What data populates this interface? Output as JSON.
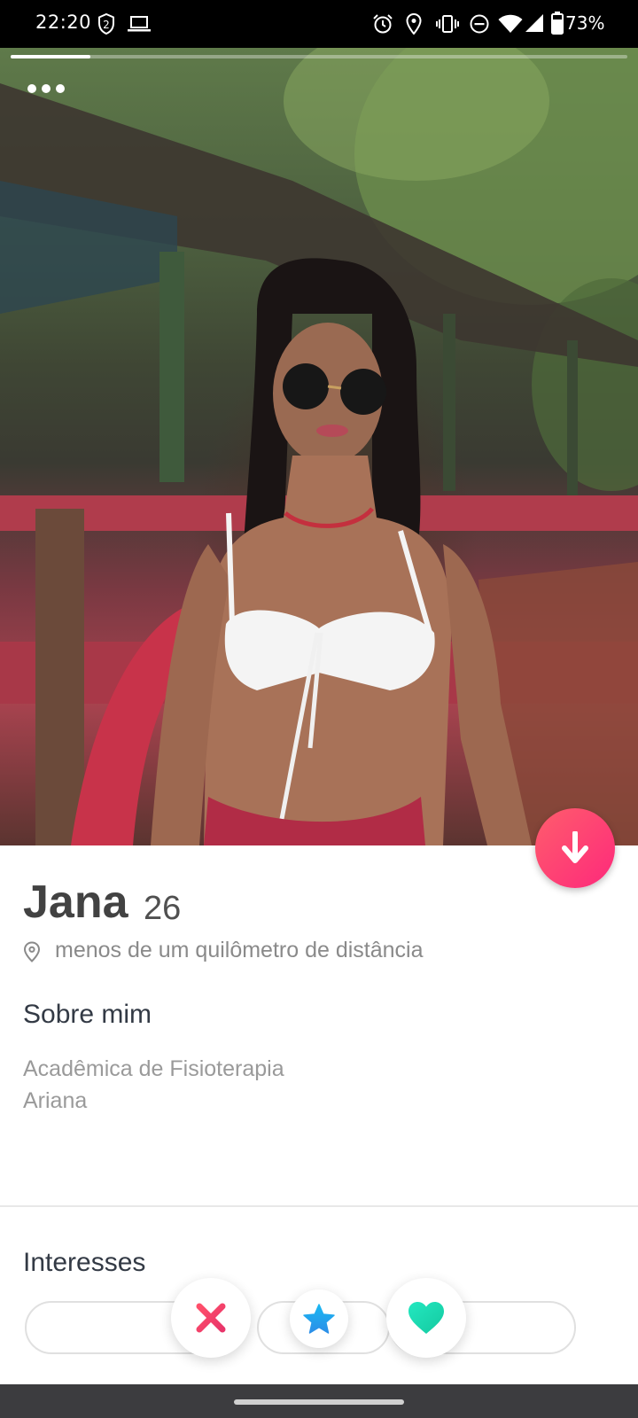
{
  "status_bar": {
    "time": "22:20",
    "battery": "73%",
    "icons": [
      "two-step-icon",
      "laptop-icon",
      "alarm-icon",
      "location-icon",
      "vibrate-icon",
      "dnd-icon",
      "wifi-icon",
      "signal-icon",
      "battery-icon"
    ]
  },
  "photo": {
    "progress_fraction": 0.13,
    "options_icon": "more-dots-icon"
  },
  "profile": {
    "name": "Jana",
    "age": "26",
    "distance": "menos de um quilômetro de distância"
  },
  "about": {
    "title": "Sobre mim",
    "lines": [
      "Acadêmica de Fisioterapia",
      "Ariana"
    ]
  },
  "interests": {
    "title": "Interesses"
  },
  "actions": {
    "dislike_icon": "close-icon",
    "super_like_icon": "star-icon",
    "like_icon": "heart-icon",
    "collapse_icon": "arrow-down-icon"
  },
  "colors": {
    "brand_gradient_start": "#ff5d6c",
    "brand_gradient_end": "#fd297b",
    "dislike": "#f0446b",
    "super_like": "#1fa8f0",
    "like": "#1ee5b4"
  }
}
